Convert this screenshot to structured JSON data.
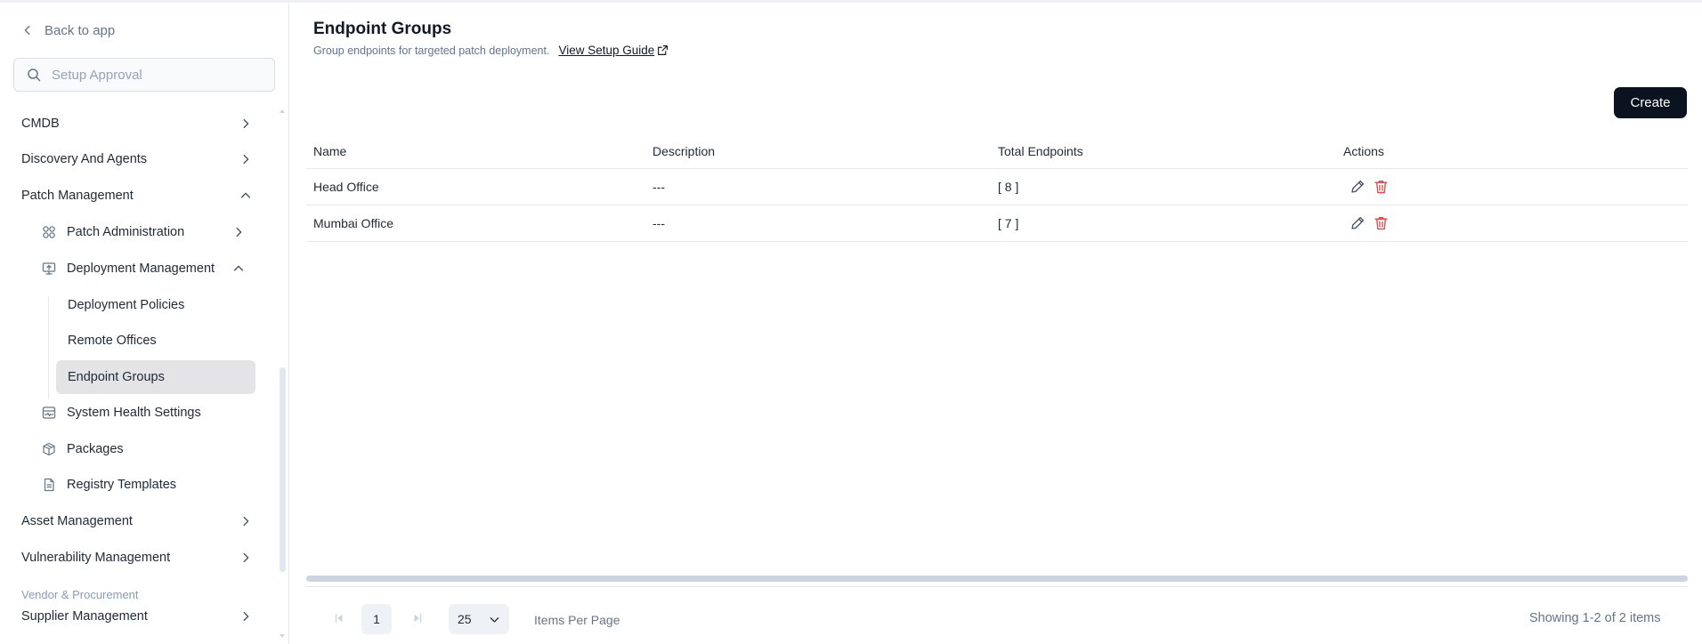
{
  "sidebar": {
    "back_label": "Back to app",
    "search_placeholder": "Setup Approval",
    "items": [
      {
        "label": "CMDB"
      },
      {
        "label": "Discovery And Agents"
      },
      {
        "label": "Patch Management"
      },
      {
        "label": "Patch Administration",
        "icon": "grid-icon"
      },
      {
        "label": "Deployment Management",
        "icon": "monitor-upload-icon"
      },
      {
        "label": "Deployment Policies"
      },
      {
        "label": "Remote Offices"
      },
      {
        "label": "Endpoint Groups"
      },
      {
        "label": "System Health Settings",
        "icon": "health-panel-icon"
      },
      {
        "label": "Packages",
        "icon": "package-icon"
      },
      {
        "label": "Registry Templates",
        "icon": "document-icon"
      },
      {
        "label": "Asset Management"
      },
      {
        "label": "Vulnerability Management"
      },
      {
        "label": "Supplier Management"
      }
    ],
    "section_label": "Vendor & Procurement"
  },
  "header": {
    "title": "Endpoint Groups",
    "subtitle": "Group endpoints for targeted patch deployment.",
    "guide_label": "View Setup Guide",
    "create_label": "Create"
  },
  "table": {
    "columns": [
      "Name",
      "Description",
      "Total Endpoints",
      "Actions"
    ],
    "rows": [
      {
        "name": "Head Office",
        "description": "---",
        "total": "[ 8 ]"
      },
      {
        "name": "Mumbai Office",
        "description": "---",
        "total": "[ 7 ]"
      }
    ]
  },
  "pagination": {
    "current_page": "1",
    "per_page": "25",
    "per_page_label": "Items Per Page",
    "showing": "Showing 1-2 of 2 items"
  },
  "colors": {
    "primary_button": "#0b1220",
    "delete_icon": "#ef4444",
    "edit_icon": "#475569",
    "active_item_bg": "#e4e4e7"
  }
}
